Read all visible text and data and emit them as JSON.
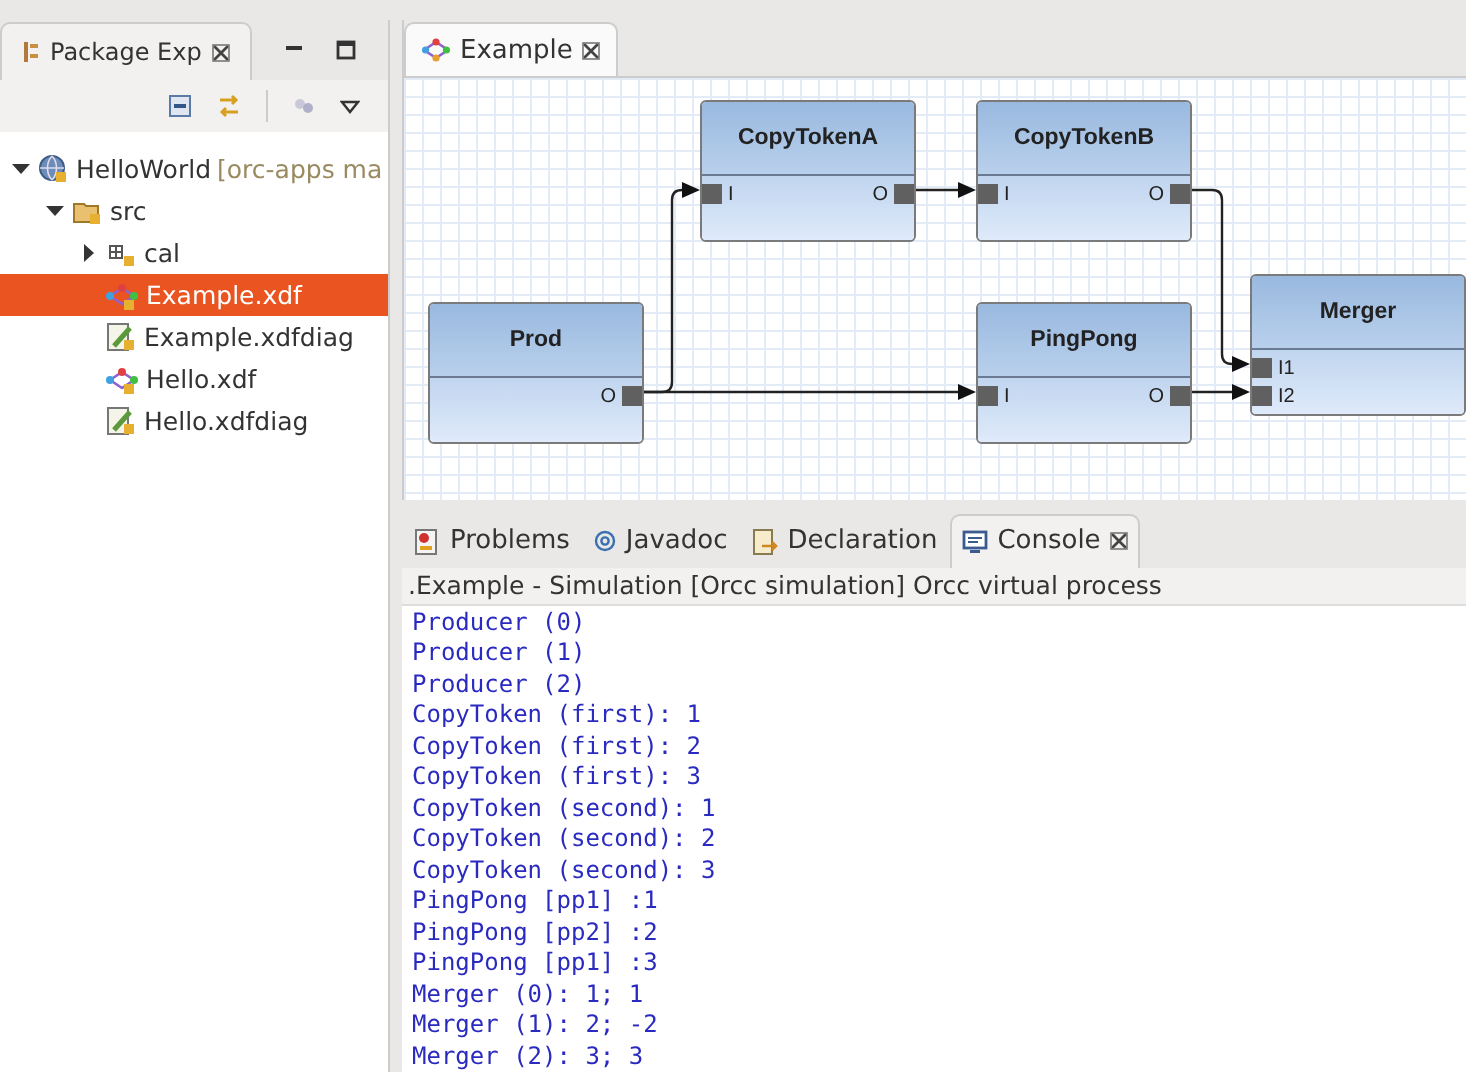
{
  "package_explorer": {
    "tab": {
      "label": "Package Exp",
      "selected": true
    },
    "tree": [
      {
        "label": "HelloWorld",
        "decoration": "[orc-apps ma",
        "kind": "project",
        "expanded": true,
        "selected": false,
        "children": [
          {
            "label": "src",
            "kind": "source-folder",
            "expanded": true,
            "selected": false,
            "children": [
              {
                "label": "cal",
                "kind": "package",
                "expanded": false,
                "selected": false
              },
              {
                "label": "Example.xdf",
                "kind": "network",
                "selected": true
              },
              {
                "label": "Example.xdfdiag",
                "kind": "diagram",
                "selected": false
              },
              {
                "label": "Hello.xdf",
                "kind": "network",
                "selected": false
              },
              {
                "label": "Hello.xdfdiag",
                "kind": "diagram",
                "selected": false
              }
            ]
          }
        ]
      }
    ]
  },
  "editor": {
    "tabs": [
      {
        "label": "Example",
        "selected": true
      }
    ],
    "diagram": {
      "nodes": [
        {
          "name": "Prod",
          "outputs": [
            "O"
          ]
        },
        {
          "name": "CopyTokenA",
          "inputs": [
            "I"
          ],
          "outputs": [
            "O"
          ]
        },
        {
          "name": "CopyTokenB",
          "inputs": [
            "I"
          ],
          "outputs": [
            "O"
          ]
        },
        {
          "name": "PingPong",
          "inputs": [
            "I"
          ],
          "outputs": [
            "O"
          ]
        },
        {
          "name": "Merger",
          "inputs": [
            "I1",
            "I2"
          ]
        }
      ]
    }
  },
  "console": {
    "tabs": [
      {
        "label": "Problems",
        "kind": "problems",
        "selected": false
      },
      {
        "label": "Javadoc",
        "kind": "javadoc",
        "selected": false
      },
      {
        "label": "Declaration",
        "kind": "declaration",
        "selected": false
      },
      {
        "label": "Console",
        "kind": "console",
        "selected": true
      }
    ],
    "process_title": ".Example - Simulation [Orcc simulation] Orcc virtual process",
    "lines": [
      "Producer (0)",
      "Producer (1)",
      "Producer (2)",
      "CopyToken (first): 1",
      "CopyToken (first): 2",
      "CopyToken (first): 3",
      "CopyToken (second): 1",
      "CopyToken (second): 2",
      "CopyToken (second): 3",
      "PingPong [pp1] :1",
      "PingPong [pp2] :2",
      "PingPong [pp1] :3",
      "Merger (0): 1; 1",
      "Merger (1): 2; -2",
      "Merger (2): 3; 3"
    ]
  }
}
